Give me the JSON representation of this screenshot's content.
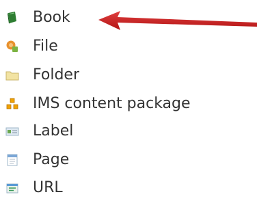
{
  "resources": {
    "items": [
      {
        "label": "Book",
        "icon": "book-icon"
      },
      {
        "label": "File",
        "icon": "file-icon"
      },
      {
        "label": "Folder",
        "icon": "folder-icon"
      },
      {
        "label": "IMS content package",
        "icon": "ims-package-icon"
      },
      {
        "label": "Label",
        "icon": "label-icon"
      },
      {
        "label": "Page",
        "icon": "page-icon"
      },
      {
        "label": "URL",
        "icon": "url-icon"
      }
    ]
  },
  "annotation": {
    "arrow_color": "#cc1f1f",
    "points_to": "Book"
  },
  "colors": {
    "text": "#333333",
    "book_green": "#2e7d32",
    "file_orange": "#e8912d",
    "folder_yellow": "#f2e3a3"
  }
}
